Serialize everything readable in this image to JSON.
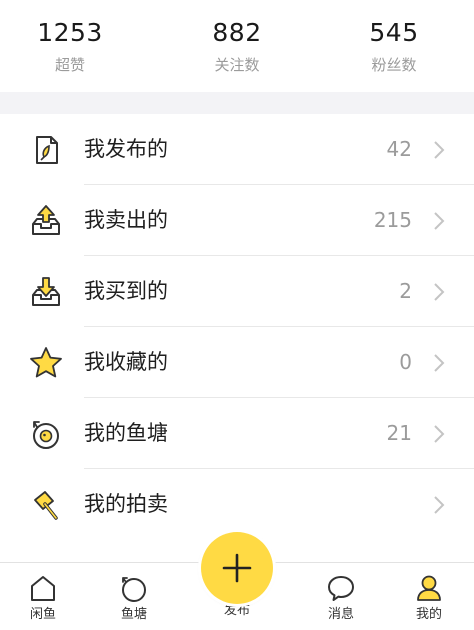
{
  "stats": [
    {
      "value": "1253",
      "label": "超赞"
    },
    {
      "value": "882",
      "label": "关注数"
    },
    {
      "value": "545",
      "label": "粉丝数"
    }
  ],
  "menu": [
    {
      "label": "我发布的",
      "count": "42",
      "icon": "document-icon"
    },
    {
      "label": "我卖出的",
      "count": "215",
      "icon": "box-upload-icon"
    },
    {
      "label": "我买到的",
      "count": "2",
      "icon": "box-download-icon"
    },
    {
      "label": "我收藏的",
      "count": "0",
      "icon": "star-icon"
    },
    {
      "label": "我的鱼塘",
      "count": "21",
      "icon": "fishpond-icon"
    },
    {
      "label": "我的拍卖",
      "count": "",
      "icon": "auction-hammer-icon"
    }
  ],
  "tabs": [
    {
      "label": "闲鱼",
      "icon": "home-icon"
    },
    {
      "label": "鱼塘",
      "icon": "fishpond-icon"
    },
    {
      "label": "发布",
      "icon": "plus-icon"
    },
    {
      "label": "消息",
      "icon": "chat-bubble-icon"
    },
    {
      "label": "我的",
      "icon": "profile-icon"
    }
  ],
  "colors": {
    "accent": "#ffda44",
    "icon_outline": "#333333",
    "muted_text": "#9b9b9b",
    "divider": "#e8e8e8",
    "section_gap": "#f3f3f6"
  }
}
